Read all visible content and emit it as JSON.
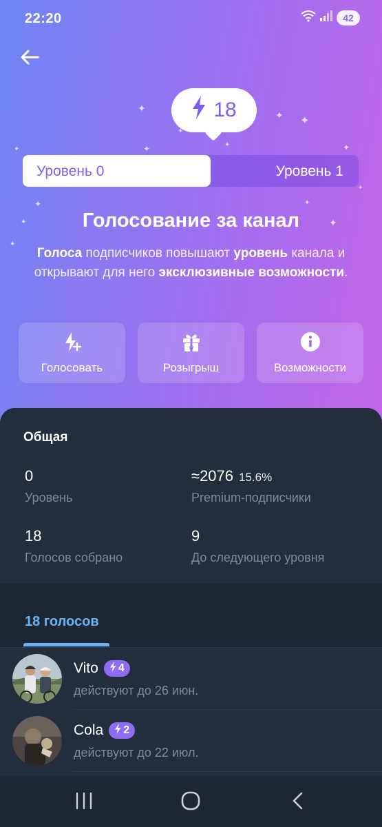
{
  "status_bar": {
    "time": "22:20",
    "battery": "42"
  },
  "boost": {
    "count": "18",
    "icon": "lightning-icon"
  },
  "level_bar": {
    "left_label": "Уровень 0",
    "right_label": "Уровень 1",
    "progress": 0.56
  },
  "hero": {
    "title": "Голосование за канал",
    "desc": {
      "p1": "Голоса",
      "p2": " подписчиков повышают ",
      "p3": "уровень",
      "p4": " канала и открывают для него ",
      "p5": "эксклюзивные возможности",
      "p6": "."
    }
  },
  "actions": [
    {
      "label": "Голосовать",
      "icon": "boost-add-icon"
    },
    {
      "label": "Розыгрыш",
      "icon": "gift-icon"
    },
    {
      "label": "Возможности",
      "icon": "info-icon"
    }
  ],
  "stats": {
    "title": "Общая",
    "level": {
      "value": "0",
      "label": "Уровень"
    },
    "premium": {
      "value": "≈2076",
      "extra": "15.6%",
      "label": "Premium-подписчики"
    },
    "votes": {
      "value": "18",
      "label": "Голосов собрано"
    },
    "next": {
      "value": "9",
      "label": "До следующего уровня"
    }
  },
  "tabs": {
    "votes_label": "18 голосов"
  },
  "voters": [
    {
      "name": "Vito",
      "boosts": "4",
      "until": "действуют до 26 июн."
    },
    {
      "name": "Cola",
      "boosts": "2",
      "until": "действуют до 22 июл."
    }
  ],
  "colors": {
    "accent": "#8e6cf6",
    "link": "#6ab3f3",
    "sheet": "#222e3c",
    "bg": "#1c2733"
  }
}
